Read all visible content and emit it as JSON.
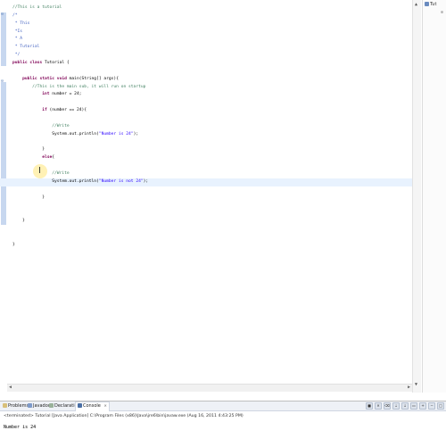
{
  "editor": {
    "lines": [
      {
        "type": "comment",
        "text": "//This is a tutorial"
      },
      {
        "type": "javadoc",
        "text": "/*"
      },
      {
        "type": "javadoc",
        "text": " * This"
      },
      {
        "type": "javadoc",
        "text": " *Is"
      },
      {
        "type": "javadoc",
        "text": " * A"
      },
      {
        "type": "javadoc",
        "text": " * Tutorial"
      },
      {
        "type": "javadoc",
        "text": " */"
      },
      {
        "type": "classdecl",
        "kw": "public class ",
        "rest": "Tutorial {"
      },
      {
        "type": "blank",
        "text": ""
      },
      {
        "type": "methoddecl",
        "indent": "    ",
        "kw": "public static void ",
        "rest": "main(String[] args){"
      },
      {
        "type": "comment",
        "indent": "        ",
        "text": "//This is the main sub, it will run on startup"
      },
      {
        "type": "intdecl",
        "indent": "            ",
        "kw": "int ",
        "rest": "number = 24;"
      },
      {
        "type": "blank",
        "text": ""
      },
      {
        "type": "ifline",
        "indent": "            ",
        "kw": "if ",
        "rest": "(number == 24){"
      },
      {
        "type": "blank",
        "text": ""
      },
      {
        "type": "comment",
        "indent": "                ",
        "text": "//Write"
      },
      {
        "type": "println",
        "indent": "                ",
        "pre": "System.out.println(",
        "str": "\"Number is 24\"",
        "post": ");"
      },
      {
        "type": "blank",
        "text": ""
      },
      {
        "type": "plain",
        "indent": "            ",
        "text": "}"
      },
      {
        "type": "kwline",
        "indent": "            ",
        "kw": "else",
        "rest": "{"
      },
      {
        "type": "blank",
        "text": ""
      },
      {
        "type": "comment",
        "indent": "                ",
        "text": "//Write"
      },
      {
        "type": "println",
        "indent": "                ",
        "pre": "System.out.println(",
        "str": "\"Number is not 24\"",
        "post": ");",
        "current": true
      },
      {
        "type": "blank",
        "text": ""
      },
      {
        "type": "plain",
        "indent": "            ",
        "text": "}"
      },
      {
        "type": "blank",
        "text": ""
      },
      {
        "type": "blank",
        "text": ""
      },
      {
        "type": "plain",
        "indent": "    ",
        "text": "}"
      },
      {
        "type": "blank",
        "text": ""
      },
      {
        "type": "blank",
        "text": ""
      },
      {
        "type": "plain",
        "text": "}"
      }
    ]
  },
  "outline_panel": {
    "tab_label": "Tut"
  },
  "console": {
    "tabs": [
      {
        "label": "Problems",
        "icon": "problems-icon"
      },
      {
        "label": "Javadoc",
        "icon": "javadoc-icon"
      },
      {
        "label": "Declaration",
        "icon": "declaration-icon"
      },
      {
        "label": "Console",
        "icon": "console-icon",
        "active": true,
        "close": "✕"
      }
    ],
    "status": "<terminated> Tutorial [Java Application] C:\\Program Files (x86)\\Java\\jre6\\bin\\javaw.exe (Aug 16, 2011 4:43:25 PM)",
    "output": "Number is 24"
  },
  "colors": {
    "keyword": "#7f0055",
    "comment": "#3f7f5f",
    "javadoc": "#3f5fbf",
    "string": "#2a00ff",
    "current_line": "#e8f2fe"
  }
}
